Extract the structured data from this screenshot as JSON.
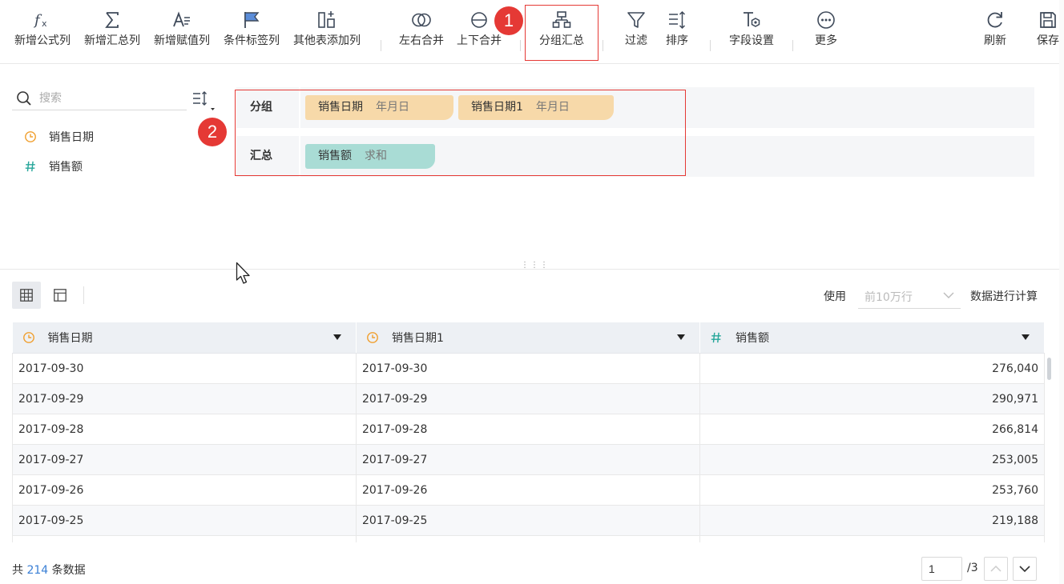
{
  "toolbar": {
    "items": [
      {
        "label": "新增公式列",
        "icon": "formula-icon"
      },
      {
        "label": "新增汇总列",
        "icon": "sigma-icon"
      },
      {
        "label": "新增赋值列",
        "icon": "assign-value-icon"
      },
      {
        "label": "条件标签列",
        "icon": "flag-icon"
      },
      {
        "label": "其他表添加列",
        "icon": "add-column-icon"
      },
      {
        "label": "左右合并",
        "icon": "left-right-merge-icon"
      },
      {
        "label": "上下合并",
        "icon": "up-down-merge-icon"
      },
      {
        "label": "分组汇总",
        "icon": "group-summary-icon"
      },
      {
        "label": "过滤",
        "icon": "filter-icon"
      },
      {
        "label": "排序",
        "icon": "sort-icon"
      },
      {
        "label": "字段设置",
        "icon": "field-settings-icon"
      },
      {
        "label": "更多",
        "icon": "more-icon"
      },
      {
        "label": "刷新",
        "icon": "refresh-icon"
      },
      {
        "label": "保存",
        "icon": "save-icon"
      }
    ]
  },
  "markers": {
    "one": "1",
    "two": "2"
  },
  "field_panel": {
    "search_placeholder": "搜索",
    "fields": [
      {
        "name": "销售日期",
        "type": "date"
      },
      {
        "name": "销售额",
        "type": "number"
      }
    ]
  },
  "config": {
    "group_label": "分组",
    "summary_label": "汇总",
    "group_chips": [
      {
        "name": "销售日期",
        "agg": "年月日"
      },
      {
        "name": "销售日期1",
        "agg": "年月日"
      }
    ],
    "summary_chips": [
      {
        "name": "销售额",
        "agg": "求和"
      }
    ]
  },
  "data_view": {
    "use_label": "使用",
    "row_limit": "前10万行",
    "calc_label": "数据进行计算"
  },
  "table": {
    "columns": [
      {
        "name": "销售日期",
        "type": "date"
      },
      {
        "name": "销售日期1",
        "type": "date"
      },
      {
        "name": "销售额",
        "type": "number"
      }
    ],
    "rows": [
      [
        "2017-09-30",
        "2017-09-30",
        "276,040"
      ],
      [
        "2017-09-29",
        "2017-09-29",
        "290,971"
      ],
      [
        "2017-09-28",
        "2017-09-28",
        "266,814"
      ],
      [
        "2017-09-27",
        "2017-09-27",
        "253,005"
      ],
      [
        "2017-09-26",
        "2017-09-26",
        "253,760"
      ],
      [
        "2017-09-25",
        "2017-09-25",
        "219,188"
      ],
      [
        "",
        "",
        ""
      ]
    ]
  },
  "footer": {
    "total_prefix": "共",
    "total_count": "214",
    "total_suffix": "条数据",
    "page_value": "1",
    "page_total": "/3"
  },
  "colors": {
    "accent_red": "#e53935",
    "chip_orange": "#f7d9a9",
    "chip_teal": "#a9dcd5",
    "date_icon": "#f0a030",
    "number_icon": "#26a69a",
    "link_blue": "#3a7fd5"
  }
}
